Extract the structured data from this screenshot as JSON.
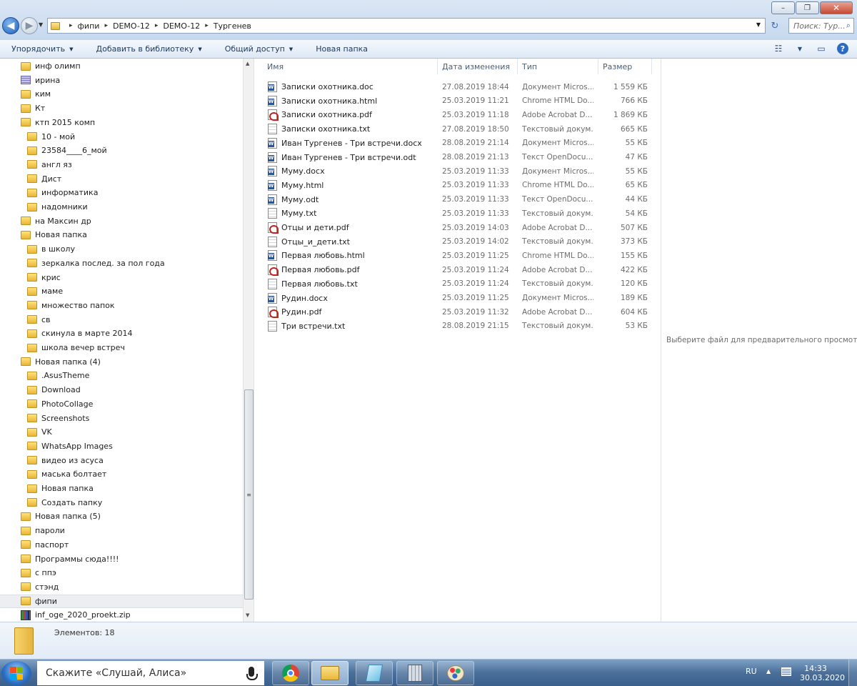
{
  "window": {
    "minimize": "–",
    "maximize": "❐",
    "close": "✕"
  },
  "address": {
    "crumbs": [
      "фипи",
      "DEMO-12",
      "DEMO-12",
      "Тургенев"
    ],
    "separator": "▸",
    "dropdown": "▼"
  },
  "search": {
    "placeholder": "Поиск: Тур...",
    "icon": "search-icon"
  },
  "commandbar": {
    "items": [
      {
        "label": "Упорядочить",
        "has_arrow": true
      },
      {
        "label": "Добавить в библиотеку",
        "has_arrow": true
      },
      {
        "label": "Общий доступ",
        "has_arrow": true
      },
      {
        "label": "Новая папка",
        "has_arrow": false
      }
    ],
    "arrow": "▼"
  },
  "navpane": {
    "items": [
      {
        "label": "инф олимп",
        "icon": "folder",
        "level": 0
      },
      {
        "label": "ирина",
        "icon": "library",
        "level": 0
      },
      {
        "label": "ким",
        "icon": "folder",
        "level": 0
      },
      {
        "label": "Кт",
        "icon": "folder",
        "level": 0
      },
      {
        "label": "ктп 2015 комп",
        "icon": "folder",
        "level": 0
      },
      {
        "label": "10 - мой",
        "icon": "folder",
        "level": 1
      },
      {
        "label": "23584____6_мой",
        "icon": "folder",
        "level": 1
      },
      {
        "label": "англ яз",
        "icon": "folder",
        "level": 1
      },
      {
        "label": "Дист",
        "icon": "folder",
        "level": 1
      },
      {
        "label": "информатика",
        "icon": "folder",
        "level": 1
      },
      {
        "label": "надомники",
        "icon": "folder",
        "level": 1
      },
      {
        "label": "на Максин  др",
        "icon": "folder",
        "level": 0
      },
      {
        "label": "Новая папка",
        "icon": "folder",
        "level": 0
      },
      {
        "label": "в школу",
        "icon": "folder",
        "level": 1
      },
      {
        "label": "зеркалка послед. за пол года",
        "icon": "folder",
        "level": 1
      },
      {
        "label": "крис",
        "icon": "folder",
        "level": 1
      },
      {
        "label": "маме",
        "icon": "folder",
        "level": 1
      },
      {
        "label": "множество папок",
        "icon": "folder",
        "level": 1
      },
      {
        "label": "св",
        "icon": "folder",
        "level": 1
      },
      {
        "label": "скинула в марте 2014",
        "icon": "folder",
        "level": 1
      },
      {
        "label": "школа вечер встреч",
        "icon": "folder",
        "level": 1
      },
      {
        "label": "Новая папка (4)",
        "icon": "folder",
        "level": 0
      },
      {
        "label": ".AsusTheme",
        "icon": "folder",
        "level": 1
      },
      {
        "label": "Download",
        "icon": "folder",
        "level": 1
      },
      {
        "label": "PhotoCollage",
        "icon": "folder",
        "level": 1
      },
      {
        "label": "Screenshots",
        "icon": "folder",
        "level": 1
      },
      {
        "label": "VK",
        "icon": "folder",
        "level": 1
      },
      {
        "label": "WhatsApp Images",
        "icon": "folder",
        "level": 1
      },
      {
        "label": "видео из асуса",
        "icon": "folder",
        "level": 1
      },
      {
        "label": "маська болтает",
        "icon": "folder",
        "level": 1
      },
      {
        "label": "Новая папка",
        "icon": "folder",
        "level": 1
      },
      {
        "label": "Создать папку",
        "icon": "folder",
        "level": 1
      },
      {
        "label": "Новая папка (5)",
        "icon": "folder",
        "level": 0
      },
      {
        "label": "пароли",
        "icon": "folder",
        "level": 0
      },
      {
        "label": "паспорт",
        "icon": "folder",
        "level": 0
      },
      {
        "label": "Программы сюда!!!!",
        "icon": "folder",
        "level": 0
      },
      {
        "label": "с ппэ",
        "icon": "folder",
        "level": 0
      },
      {
        "label": "стэнд",
        "icon": "folder",
        "level": 0
      },
      {
        "label": "фипи",
        "icon": "folder",
        "level": 0,
        "selected": true
      },
      {
        "label": "inf_oge_2020_proekt.zip",
        "icon": "zip",
        "level": 0
      }
    ]
  },
  "filelist": {
    "columns": {
      "name": "Имя",
      "date": "Дата изменения",
      "type": "Тип",
      "size": "Размер"
    },
    "files": [
      {
        "name": "Записки охотника.doc",
        "date": "27.08.2019 18:44",
        "type": "Документ Micros...",
        "size": "1 559 КБ",
        "icon": "word"
      },
      {
        "name": "Записки охотника.html",
        "date": "25.03.2019 11:21",
        "type": "Chrome HTML Do...",
        "size": "766 КБ",
        "icon": "word"
      },
      {
        "name": "Записки охотника.pdf",
        "date": "25.03.2019 11:18",
        "type": "Adobe Acrobat D...",
        "size": "1 869 КБ",
        "icon": "pdf"
      },
      {
        "name": "Записки охотника.txt",
        "date": "27.08.2019 18:50",
        "type": "Текстовый докум...",
        "size": "665 КБ",
        "icon": "txt"
      },
      {
        "name": "Иван Тургенев - Три встречи.docx",
        "date": "28.08.2019 21:14",
        "type": "Документ Micros...",
        "size": "55 КБ",
        "icon": "word"
      },
      {
        "name": "Иван Тургенев - Три встречи.odt",
        "date": "28.08.2019 21:13",
        "type": "Текст OpenDocu...",
        "size": "47 КБ",
        "icon": "word"
      },
      {
        "name": "Муму.docx",
        "date": "25.03.2019 11:33",
        "type": "Документ Micros...",
        "size": "55 КБ",
        "icon": "word"
      },
      {
        "name": "Муму.html",
        "date": "25.03.2019 11:33",
        "type": "Chrome HTML Do...",
        "size": "65 КБ",
        "icon": "word"
      },
      {
        "name": "Муму.odt",
        "date": "25.03.2019 11:33",
        "type": "Текст OpenDocu...",
        "size": "44 КБ",
        "icon": "word"
      },
      {
        "name": "Муму.txt",
        "date": "25.03.2019 11:33",
        "type": "Текстовый докум...",
        "size": "54 КБ",
        "icon": "txt"
      },
      {
        "name": "Отцы и дети.pdf",
        "date": "25.03.2019 14:03",
        "type": "Adobe Acrobat D...",
        "size": "507 КБ",
        "icon": "pdf"
      },
      {
        "name": "Отцы_и_дети.txt",
        "date": "25.03.2019 14:02",
        "type": "Текстовый докум...",
        "size": "373 КБ",
        "icon": "txt"
      },
      {
        "name": "Первая любовь.html",
        "date": "25.03.2019 11:25",
        "type": "Chrome HTML Do...",
        "size": "155 КБ",
        "icon": "word"
      },
      {
        "name": "Первая любовь.pdf",
        "date": "25.03.2019 11:24",
        "type": "Adobe Acrobat D...",
        "size": "422 КБ",
        "icon": "pdf"
      },
      {
        "name": "Первая любовь.txt",
        "date": "25.03.2019 11:24",
        "type": "Текстовый докум...",
        "size": "120 КБ",
        "icon": "txt"
      },
      {
        "name": "Рудин.docx",
        "date": "25.03.2019 11:25",
        "type": "Документ Micros...",
        "size": "189 КБ",
        "icon": "word"
      },
      {
        "name": "Рудин.pdf",
        "date": "25.03.2019 11:32",
        "type": "Adobe Acrobat D...",
        "size": "604 КБ",
        "icon": "pdf"
      },
      {
        "name": "Три встречи.txt",
        "date": "28.08.2019 21:15",
        "type": "Текстовый докум...",
        "size": "53 КБ",
        "icon": "txt"
      }
    ]
  },
  "preview": {
    "text": "Выберите файл для предварительного просмотра."
  },
  "details": {
    "item_count": "Элементов: 18"
  },
  "taskbar": {
    "alice_prompt": "Скажите «Слушай, Алиса»",
    "apps": [
      "chrome-icon",
      "explorer-icon",
      "notes-icon",
      "calculator-icon",
      "paint-icon"
    ],
    "lang": "RU",
    "tray_arrow": "▲",
    "time": "14:33",
    "date": "30.03.2020"
  },
  "colors": {
    "accent": "#1f5fb8",
    "selection": "#eceef2",
    "title_bar": "#dbe7f5"
  }
}
